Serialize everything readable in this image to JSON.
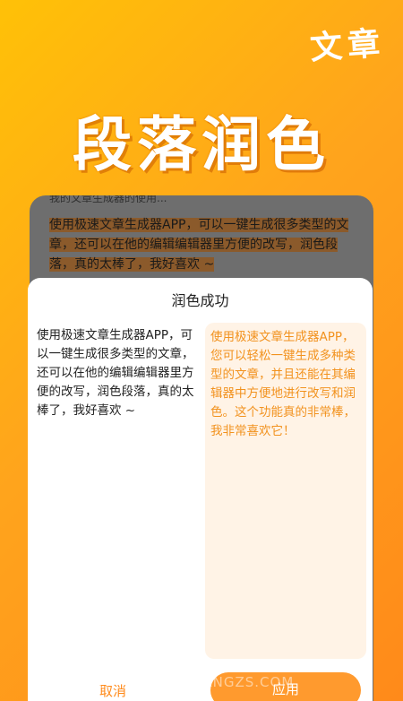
{
  "logo_text": "文章",
  "headline": "段落润色",
  "background_preview": {
    "cut_line": "我的文章生成器的使用...",
    "highlighted_text": "使用极速文章生成器APP，可以一键生成很多类型的文章，还可以在他的编辑编辑器里方便的改写，润色段落，真的太棒了，我好喜欢 ~"
  },
  "dialog": {
    "title": "润色成功",
    "original_text": "使用极速文章生成器APP，可以一键生成很多类型的文章，还可以在他的编辑编辑器里方便的改写，润色段落，真的太棒了，我好喜欢 ~",
    "polished_text": "使用极速文章生成器APP，您可以轻松一键生成多种类型的文章，并且还能在其编辑器中方便地进行改写和润色。这个功能真的非常棒，我非常喜欢它！",
    "cancel_label": "取消",
    "apply_label": "应用"
  },
  "watermark": "华创应用 • HUACHUANGZS.COM",
  "colors": {
    "accent": "#FF9A2E",
    "result_bg": "#FFF3E6",
    "result_text": "#F2921E",
    "overlay": "#6e6e6e"
  }
}
